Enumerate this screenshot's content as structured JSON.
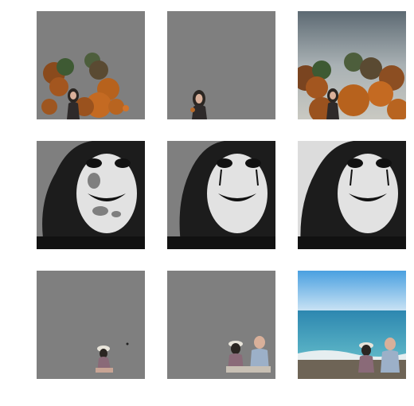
{
  "grid": {
    "rows": [
      {
        "scene": "woman-with-autumn-trees",
        "panels": [
          "mask-trees-and-person",
          "mask-person-only",
          "original-photo"
        ]
      },
      {
        "scene": "face-with-clown-makeup",
        "panels": [
          "mask-partial-face",
          "mask-full-face",
          "original-photo"
        ]
      },
      {
        "scene": "couple-sitting-at-beach",
        "panels": [
          "mask-single-person",
          "mask-couple",
          "original-photo"
        ]
      }
    ]
  },
  "colors": {
    "mask_background": "#7f7f7f",
    "page_background": "#ffffff",
    "foliage": "#b0601e",
    "sky": "#6f7f88",
    "sea": "#3f9fb8"
  }
}
